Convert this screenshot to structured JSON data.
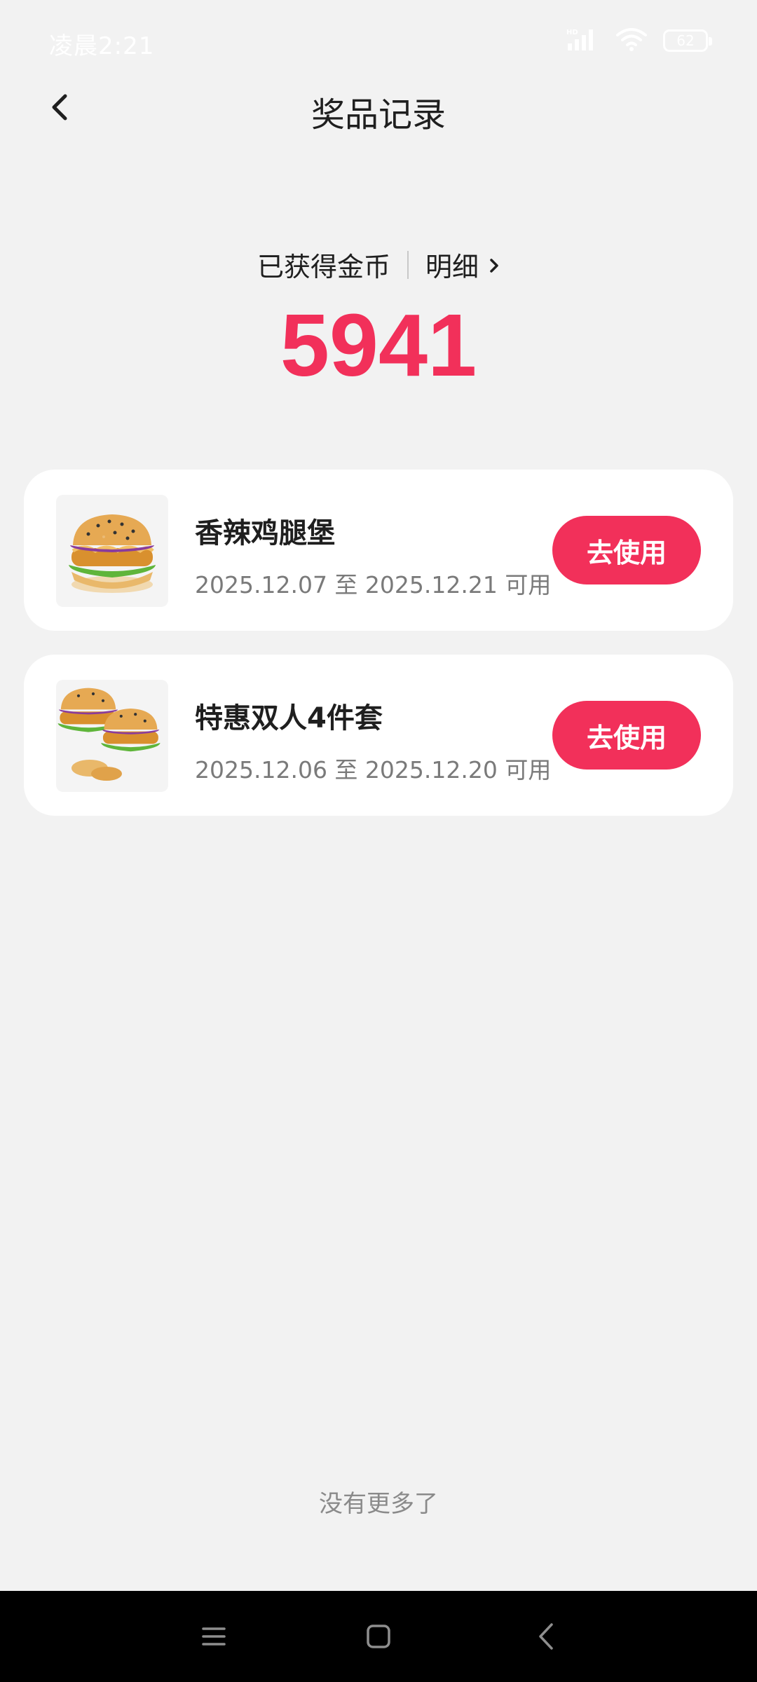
{
  "status_bar": {
    "time": "凌晨2:21",
    "battery": "62",
    "icons": [
      "hd-signal-icon",
      "wifi-icon",
      "battery-icon"
    ]
  },
  "header": {
    "title": "奖品记录",
    "back_icon": "chevron-left-icon"
  },
  "coins": {
    "label": "已获得金币",
    "detail_label": "明细",
    "value": "5941"
  },
  "prizes": [
    {
      "name": "香辣鸡腿堡",
      "validity": "2025.12.07 至 2025.12.21 可用",
      "button": "去使用",
      "image": "burger-icon"
    },
    {
      "name": "特惠双人4件套",
      "validity": "2025.12.06 至 2025.12.20 可用",
      "button": "去使用",
      "image": "burger-combo-icon"
    }
  ],
  "footer": {
    "no_more": "没有更多了"
  },
  "colors": {
    "accent": "#f2305a",
    "background": "#f2f2f2",
    "card": "#ffffff"
  }
}
